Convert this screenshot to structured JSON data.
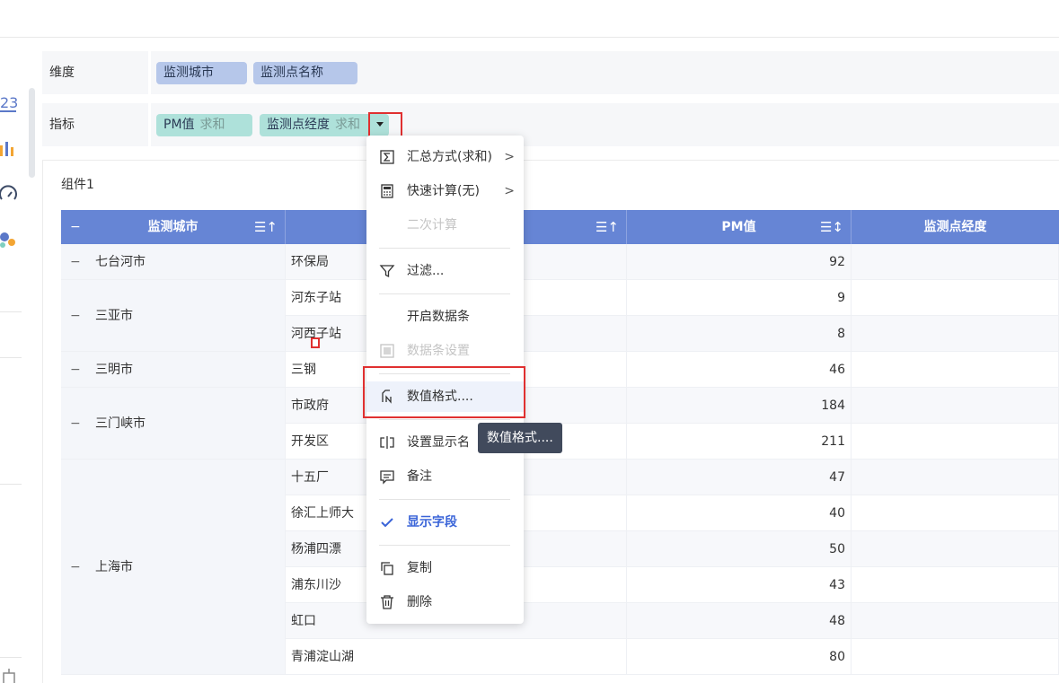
{
  "fields": {
    "dimension_label": "维度",
    "dimension_pills": [
      "监测城市",
      "监测点名称"
    ],
    "measure_label": "指标",
    "measure_pills": [
      {
        "name": "PM值",
        "agg": "求和"
      },
      {
        "name": "监测点经度",
        "agg": "求和"
      }
    ]
  },
  "panel": {
    "title": "组件1"
  },
  "table": {
    "headers": [
      "监测城市",
      "",
      "PM值",
      "监测点经度"
    ],
    "header_minus": "−",
    "sort_asc": "☰↑",
    "sort_both": "☰↕",
    "row_minus": "−",
    "groups": [
      {
        "city": "七台河市",
        "rows": [
          {
            "site": "环保局",
            "pm": "92"
          }
        ]
      },
      {
        "city": "三亚市",
        "rows": [
          {
            "site": "河东子站",
            "pm": "9"
          },
          {
            "site": "河西子站",
            "pm": "8"
          }
        ]
      },
      {
        "city": "三明市",
        "rows": [
          {
            "site": "三钢",
            "pm": "46"
          }
        ]
      },
      {
        "city": "三门峡市",
        "rows": [
          {
            "site": "市政府",
            "pm": "184"
          },
          {
            "site": "开发区",
            "pm": "211"
          }
        ]
      },
      {
        "city": "上海市",
        "rows": [
          {
            "site": "十五厂",
            "pm": "47"
          },
          {
            "site": "徐汇上师大",
            "pm": "40"
          },
          {
            "site": "杨浦四漂",
            "pm": "50"
          },
          {
            "site": "浦东川沙",
            "pm": "43"
          },
          {
            "site": "虹口",
            "pm": "48"
          },
          {
            "site": "青浦淀山湖",
            "pm": "80"
          }
        ]
      }
    ]
  },
  "menu": {
    "items": [
      {
        "label": "汇总方式(求和)",
        "icon": "sigma-icon",
        "submenu": true
      },
      {
        "label": "快速计算(无)",
        "icon": "calculator-icon",
        "submenu": true
      },
      {
        "label": "二次计算",
        "icon": "",
        "disabled": true
      },
      {
        "label": "过滤...",
        "icon": "filter-icon"
      },
      {
        "label": "开启数据条",
        "icon": ""
      },
      {
        "label": "数据条设置",
        "icon": "databar-icon",
        "disabled": true
      },
      {
        "label": "数值格式....",
        "icon": "number-format-icon",
        "hover": true
      },
      {
        "label": "设置显示名",
        "icon": "rename-icon"
      },
      {
        "label": "备注",
        "icon": "comment-icon"
      },
      {
        "label": "显示字段",
        "icon": "check-icon",
        "accent": true
      },
      {
        "label": "复制",
        "icon": "copy-icon"
      },
      {
        "label": "删除",
        "icon": "trash-icon"
      }
    ],
    "chevron": ">"
  },
  "tooltip": "数值格式....",
  "colors": {
    "header_blue": "#6685d5",
    "dim_pill": "#b6c7ea",
    "measure_pill": "#aee1da",
    "highlight_red": "#e03030",
    "accent_blue": "#3a64d8"
  }
}
